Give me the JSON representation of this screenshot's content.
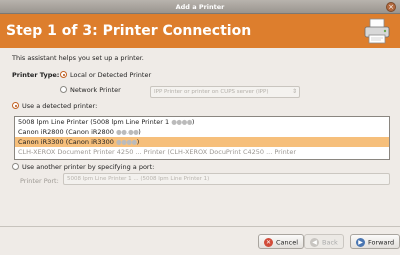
{
  "window": {
    "title": "Add a Printer"
  },
  "banner": {
    "title": "Step 1 of 3: Printer Connection"
  },
  "intro": "This assistant helps you set up a printer.",
  "printer_type": {
    "label": "Printer Type:",
    "options": [
      {
        "label": "Local or Detected Printer",
        "checked": true
      },
      {
        "label": "Network Printer",
        "checked": false
      }
    ],
    "network_field_placeholder": "IPP Printer or printer on CUPS server (IPP)"
  },
  "use_detected": {
    "label": "Use a detected printer:",
    "checked": true
  },
  "detected_printers": [
    {
      "text": "5008 lpm Line Printer (5008 lpm Line Printer 1",
      "selected": false
    },
    {
      "text": "Canon iR2800 (Canon iR2800",
      "selected": false
    },
    {
      "text": "Canon iR3300 (Canon iR3300",
      "selected": true
    },
    {
      "text": "CLH-XEROX Document Printer 4250 ... Printer (CLH-XEROX DocuPrint C4250 ... Printer",
      "selected": false
    }
  ],
  "use_port": {
    "label": "Use another printer by specifying a port:",
    "checked": false
  },
  "printer_port": {
    "label": "Printer Port:",
    "value": "5008 lpm Line Printer 1 ... (5008 lpm Line Printer 1)"
  },
  "buttons": {
    "cancel": "Cancel",
    "back": "Back",
    "forward": "Forward"
  },
  "colors": {
    "banner": "#dd7e2d",
    "selection": "#f6bf7b"
  }
}
